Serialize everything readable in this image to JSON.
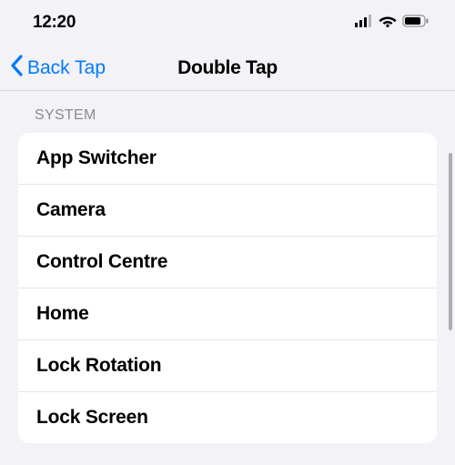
{
  "status": {
    "time": "12:20"
  },
  "nav": {
    "back_label": "Back Tap",
    "title": "Double Tap"
  },
  "section": {
    "header": "SYSTEM",
    "items": [
      {
        "label": "App Switcher"
      },
      {
        "label": "Camera"
      },
      {
        "label": "Control Centre"
      },
      {
        "label": "Home"
      },
      {
        "label": "Lock Rotation"
      },
      {
        "label": "Lock Screen"
      }
    ]
  }
}
